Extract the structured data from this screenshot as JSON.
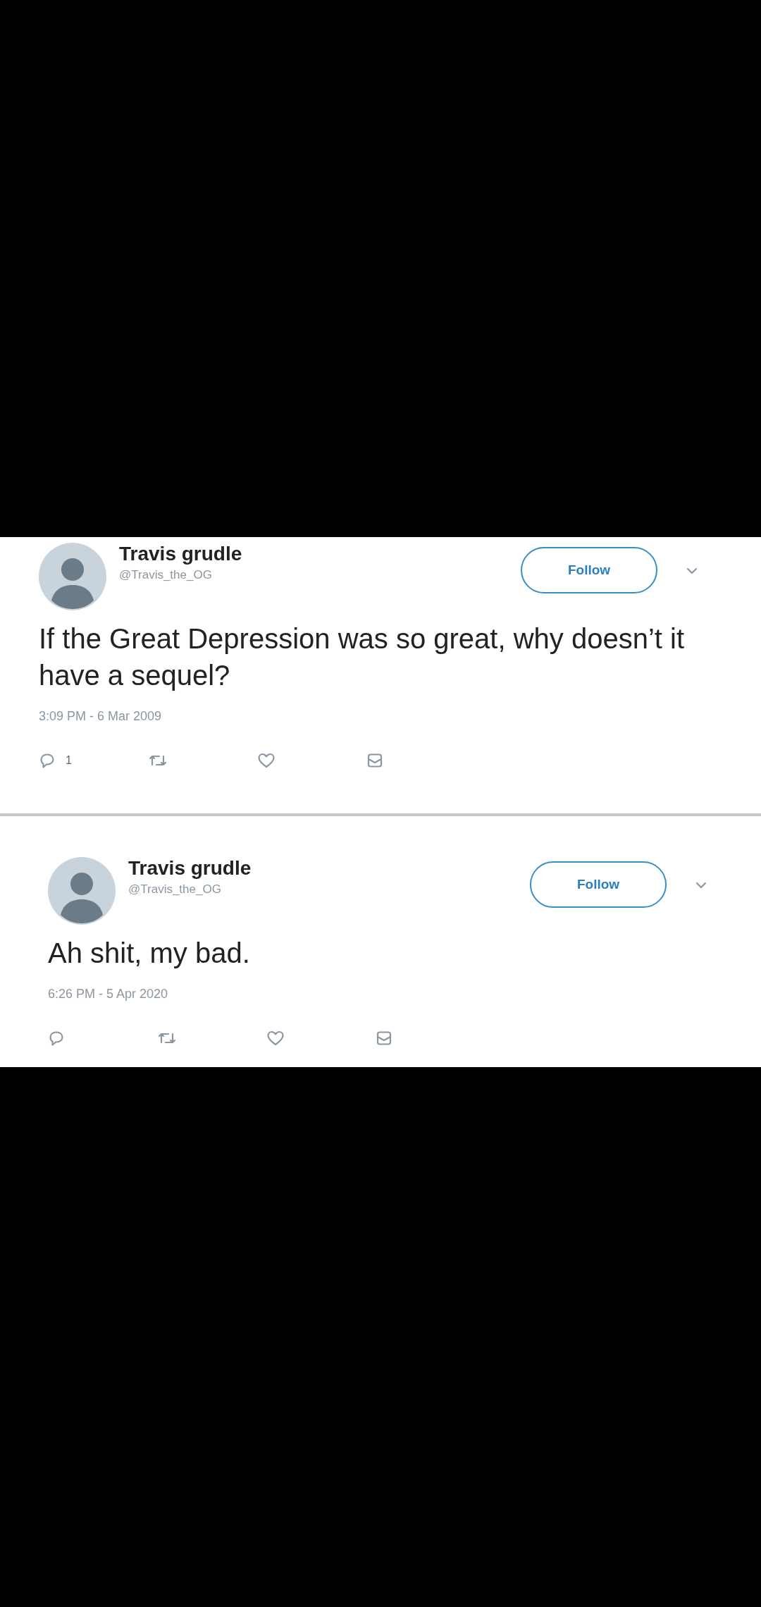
{
  "tweets": [
    {
      "name": "Travis grudle",
      "handle": "@Travis_the_OG",
      "follow": "Follow",
      "text": "If the Great Depression was so great, why doesn’t it have a sequel?",
      "timestamp": "3:09 PM - 6 Mar 2009",
      "reply_count": "1"
    },
    {
      "name": "Travis grudle",
      "handle": "@Travis_the_OG",
      "follow": "Follow",
      "text": "Ah shit, my bad.",
      "timestamp": "6:26 PM - 5 Apr 2020"
    }
  ]
}
